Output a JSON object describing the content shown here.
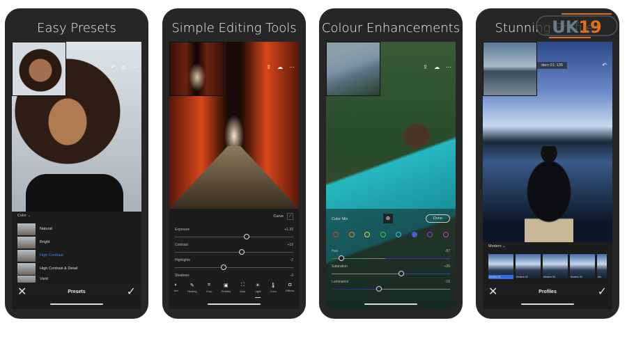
{
  "phones": [
    {
      "title": "Easy Presets",
      "filter_label": "Color",
      "presets": [
        "Natural",
        "Bright",
        "High Contrast",
        "High Contrast & Detail",
        "Vivid"
      ],
      "selected_preset": "High Contrast",
      "bottom_title": "Presets"
    },
    {
      "title": "Simple Editing Tools",
      "curve_label": "Curve",
      "sliders": [
        {
          "label": "Exposure",
          "value": "+1.33"
        },
        {
          "label": "Contrast",
          "value": "+19"
        },
        {
          "label": "Highlights",
          "value": "-7"
        },
        {
          "label": "Shadows",
          "value": "-3"
        }
      ],
      "tools": [
        "tive",
        "Healing",
        "Crop",
        "Profiles",
        "Auto",
        "Light",
        "Color",
        "Effects"
      ],
      "active_tool": "Light"
    },
    {
      "title": "Colour Enhancements",
      "panel_label": "Color Mix",
      "done_label": "Done",
      "colors": [
        "#e03a2e",
        "#e8842a",
        "#e8d82a",
        "#5cc43a",
        "#3ac4d8",
        "#4a5ad8",
        "#a03ae0",
        "#d83ad0"
      ],
      "sliders": [
        {
          "label": "Hue",
          "value": "-87"
        },
        {
          "label": "Saturation",
          "value": "+26"
        },
        {
          "label": "Luminance",
          "value": "-16"
        }
      ]
    },
    {
      "title": "Stunning Profiles",
      "header_label": "dern 01: 135",
      "group_label": "Modern",
      "profiles": [
        "Modern 01",
        "Modern 02",
        "Modern 03",
        "Modern 04",
        "Mo"
      ],
      "bottom_title": "Profiles"
    }
  ],
  "watermark": {
    "text": "UK19",
    "accent": "#e0701e"
  },
  "accent": "#2f6fe0"
}
